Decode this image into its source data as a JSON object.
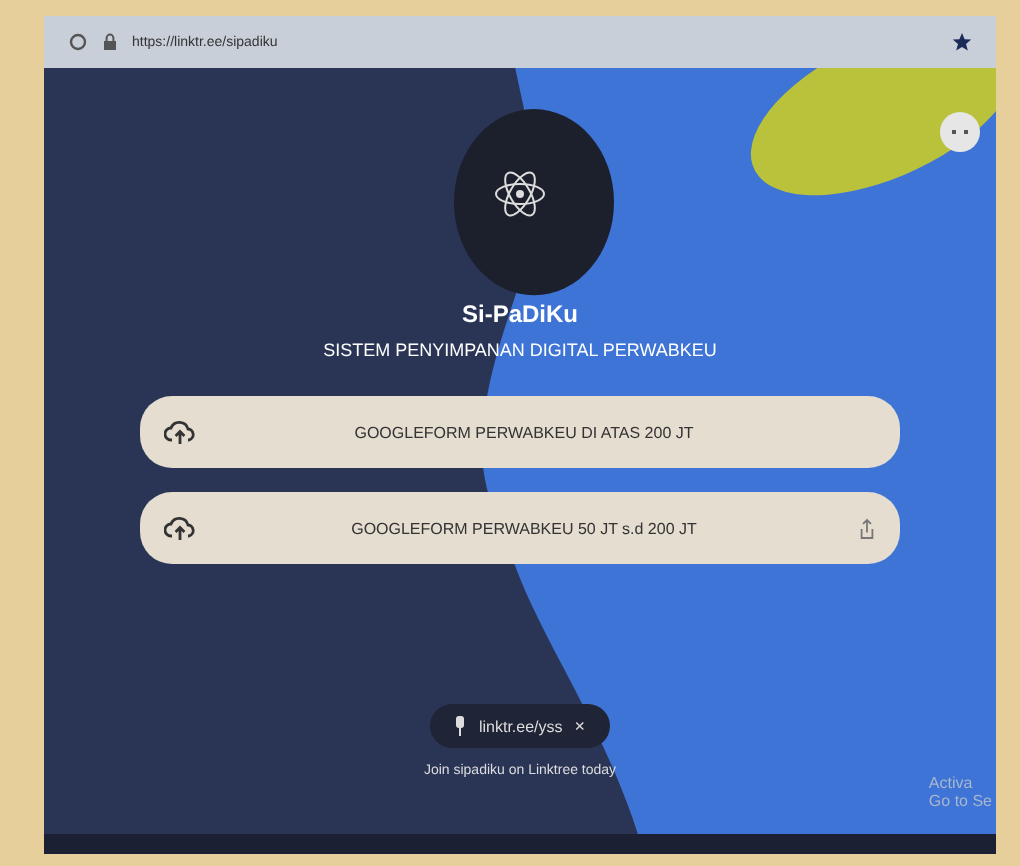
{
  "browser": {
    "url": "https://linktr.ee/sipadiku"
  },
  "profile": {
    "title": "Si-PaDiKu",
    "subtitle": "SISTEM PENYIMPANAN DIGITAL PERWABKEU"
  },
  "links": [
    {
      "label": "GOOGLEFORM PERWABKEU DI ATAS 200 JT",
      "share": false
    },
    {
      "label": "GOOGLEFORM PERWABKEU 50 JT s.d 200 JT",
      "share": true
    }
  ],
  "chip": {
    "label": "linktr.ee/yss",
    "close": "×"
  },
  "footer": {
    "text": "Join sipadiku on Linktree today"
  },
  "watermark": {
    "line_1": "Activa",
    "line_2": "Go to Se"
  }
}
